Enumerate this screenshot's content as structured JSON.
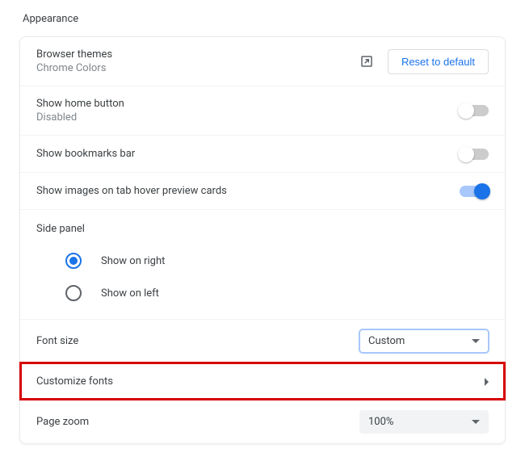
{
  "section_title": "Appearance",
  "themes": {
    "label": "Browser themes",
    "sub": "Chrome Colors",
    "reset_label": "Reset to default"
  },
  "home_button": {
    "label": "Show home button",
    "sub": "Disabled",
    "on": false
  },
  "bookmarks_bar": {
    "label": "Show bookmarks bar",
    "on": false
  },
  "tab_hover": {
    "label": "Show images on tab hover preview cards",
    "on": true
  },
  "side_panel": {
    "title": "Side panel",
    "options": [
      {
        "label": "Show on right",
        "checked": true
      },
      {
        "label": "Show on left",
        "checked": false
      }
    ]
  },
  "font_size": {
    "label": "Font size",
    "value": "Custom"
  },
  "customize_fonts": {
    "label": "Customize fonts"
  },
  "page_zoom": {
    "label": "Page zoom",
    "value": "100%"
  }
}
